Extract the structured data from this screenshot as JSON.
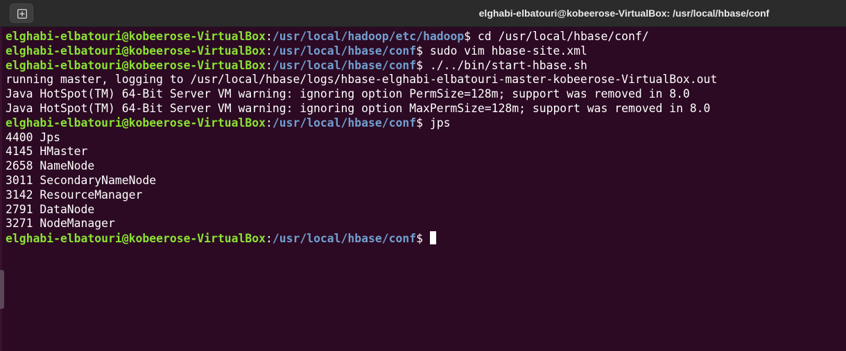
{
  "window": {
    "title": "elghabi-elbatouri@kobeerose-VirtualBox: /usr/local/hbase/conf",
    "new_tab_icon": "new-tab-icon"
  },
  "terminal": {
    "prompt_user": "elghabi-elbatouri@kobeerose-VirtualBox",
    "prompt_sep": ":",
    "prompt_end": "$ ",
    "lines": [
      {
        "kind": "prompt",
        "path": "/usr/local/hadoop/etc/hadoop",
        "cmd": "cd /usr/local/hbase/conf/"
      },
      {
        "kind": "prompt",
        "path": "/usr/local/hbase/conf",
        "cmd": "sudo vim hbase-site.xml"
      },
      {
        "kind": "prompt",
        "path": "/usr/local/hbase/conf",
        "cmd": "./../bin/start-hbase.sh"
      },
      {
        "kind": "output",
        "text": "running master, logging to /usr/local/hbase/logs/hbase-elghabi-elbatouri-master-kobeerose-VirtualBox.out"
      },
      {
        "kind": "output",
        "text": "Java HotSpot(TM) 64-Bit Server VM warning: ignoring option PermSize=128m; support was removed in 8.0"
      },
      {
        "kind": "output",
        "text": "Java HotSpot(TM) 64-Bit Server VM warning: ignoring option MaxPermSize=128m; support was removed in 8.0"
      },
      {
        "kind": "prompt",
        "path": "/usr/local/hbase/conf",
        "cmd": "jps"
      },
      {
        "kind": "output",
        "text": "4400 Jps"
      },
      {
        "kind": "output",
        "text": "4145 HMaster"
      },
      {
        "kind": "output",
        "text": "2658 NameNode"
      },
      {
        "kind": "output",
        "text": "3011 SecondaryNameNode"
      },
      {
        "kind": "output",
        "text": "3142 ResourceManager"
      },
      {
        "kind": "output",
        "text": "2791 DataNode"
      },
      {
        "kind": "output",
        "text": "3271 NodeManager"
      },
      {
        "kind": "prompt",
        "path": "/usr/local/hbase/conf",
        "cmd": "",
        "cursor": true
      }
    ]
  },
  "colors": {
    "background": "#2c0a23",
    "user": "#8ae234",
    "path": "#729fcf",
    "text": "#ffffff",
    "titlebar": "#2b2b2b"
  }
}
